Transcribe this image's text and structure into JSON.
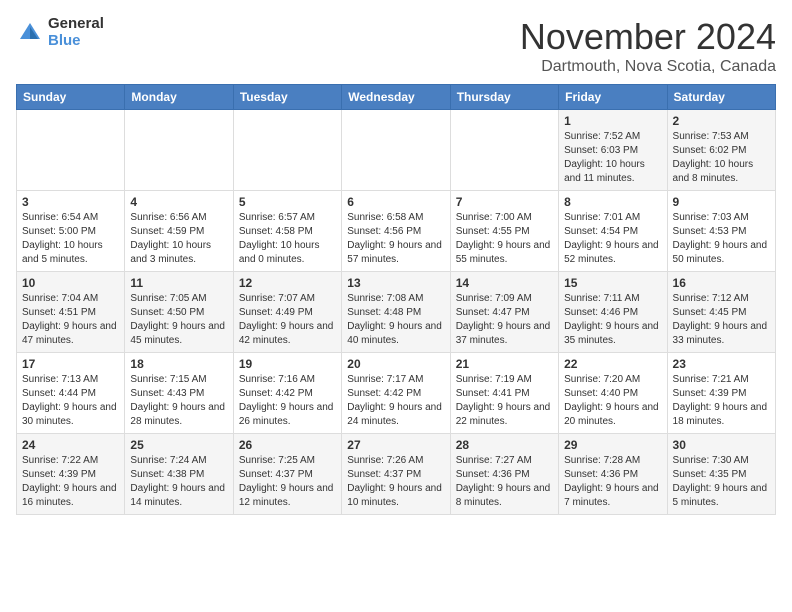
{
  "logo": {
    "general": "General",
    "blue": "Blue"
  },
  "title": "November 2024",
  "location": "Dartmouth, Nova Scotia, Canada",
  "weekdays": [
    "Sunday",
    "Monday",
    "Tuesday",
    "Wednesday",
    "Thursday",
    "Friday",
    "Saturday"
  ],
  "weeks": [
    [
      {
        "day": "",
        "info": ""
      },
      {
        "day": "",
        "info": ""
      },
      {
        "day": "",
        "info": ""
      },
      {
        "day": "",
        "info": ""
      },
      {
        "day": "",
        "info": ""
      },
      {
        "day": "1",
        "info": "Sunrise: 7:52 AM\nSunset: 6:03 PM\nDaylight: 10 hours and 11 minutes."
      },
      {
        "day": "2",
        "info": "Sunrise: 7:53 AM\nSunset: 6:02 PM\nDaylight: 10 hours and 8 minutes."
      }
    ],
    [
      {
        "day": "3",
        "info": "Sunrise: 6:54 AM\nSunset: 5:00 PM\nDaylight: 10 hours and 5 minutes."
      },
      {
        "day": "4",
        "info": "Sunrise: 6:56 AM\nSunset: 4:59 PM\nDaylight: 10 hours and 3 minutes."
      },
      {
        "day": "5",
        "info": "Sunrise: 6:57 AM\nSunset: 4:58 PM\nDaylight: 10 hours and 0 minutes."
      },
      {
        "day": "6",
        "info": "Sunrise: 6:58 AM\nSunset: 4:56 PM\nDaylight: 9 hours and 57 minutes."
      },
      {
        "day": "7",
        "info": "Sunrise: 7:00 AM\nSunset: 4:55 PM\nDaylight: 9 hours and 55 minutes."
      },
      {
        "day": "8",
        "info": "Sunrise: 7:01 AM\nSunset: 4:54 PM\nDaylight: 9 hours and 52 minutes."
      },
      {
        "day": "9",
        "info": "Sunrise: 7:03 AM\nSunset: 4:53 PM\nDaylight: 9 hours and 50 minutes."
      }
    ],
    [
      {
        "day": "10",
        "info": "Sunrise: 7:04 AM\nSunset: 4:51 PM\nDaylight: 9 hours and 47 minutes."
      },
      {
        "day": "11",
        "info": "Sunrise: 7:05 AM\nSunset: 4:50 PM\nDaylight: 9 hours and 45 minutes."
      },
      {
        "day": "12",
        "info": "Sunrise: 7:07 AM\nSunset: 4:49 PM\nDaylight: 9 hours and 42 minutes."
      },
      {
        "day": "13",
        "info": "Sunrise: 7:08 AM\nSunset: 4:48 PM\nDaylight: 9 hours and 40 minutes."
      },
      {
        "day": "14",
        "info": "Sunrise: 7:09 AM\nSunset: 4:47 PM\nDaylight: 9 hours and 37 minutes."
      },
      {
        "day": "15",
        "info": "Sunrise: 7:11 AM\nSunset: 4:46 PM\nDaylight: 9 hours and 35 minutes."
      },
      {
        "day": "16",
        "info": "Sunrise: 7:12 AM\nSunset: 4:45 PM\nDaylight: 9 hours and 33 minutes."
      }
    ],
    [
      {
        "day": "17",
        "info": "Sunrise: 7:13 AM\nSunset: 4:44 PM\nDaylight: 9 hours and 30 minutes."
      },
      {
        "day": "18",
        "info": "Sunrise: 7:15 AM\nSunset: 4:43 PM\nDaylight: 9 hours and 28 minutes."
      },
      {
        "day": "19",
        "info": "Sunrise: 7:16 AM\nSunset: 4:42 PM\nDaylight: 9 hours and 26 minutes."
      },
      {
        "day": "20",
        "info": "Sunrise: 7:17 AM\nSunset: 4:42 PM\nDaylight: 9 hours and 24 minutes."
      },
      {
        "day": "21",
        "info": "Sunrise: 7:19 AM\nSunset: 4:41 PM\nDaylight: 9 hours and 22 minutes."
      },
      {
        "day": "22",
        "info": "Sunrise: 7:20 AM\nSunset: 4:40 PM\nDaylight: 9 hours and 20 minutes."
      },
      {
        "day": "23",
        "info": "Sunrise: 7:21 AM\nSunset: 4:39 PM\nDaylight: 9 hours and 18 minutes."
      }
    ],
    [
      {
        "day": "24",
        "info": "Sunrise: 7:22 AM\nSunset: 4:39 PM\nDaylight: 9 hours and 16 minutes."
      },
      {
        "day": "25",
        "info": "Sunrise: 7:24 AM\nSunset: 4:38 PM\nDaylight: 9 hours and 14 minutes."
      },
      {
        "day": "26",
        "info": "Sunrise: 7:25 AM\nSunset: 4:37 PM\nDaylight: 9 hours and 12 minutes."
      },
      {
        "day": "27",
        "info": "Sunrise: 7:26 AM\nSunset: 4:37 PM\nDaylight: 9 hours and 10 minutes."
      },
      {
        "day": "28",
        "info": "Sunrise: 7:27 AM\nSunset: 4:36 PM\nDaylight: 9 hours and 8 minutes."
      },
      {
        "day": "29",
        "info": "Sunrise: 7:28 AM\nSunset: 4:36 PM\nDaylight: 9 hours and 7 minutes."
      },
      {
        "day": "30",
        "info": "Sunrise: 7:30 AM\nSunset: 4:35 PM\nDaylight: 9 hours and 5 minutes."
      }
    ]
  ]
}
